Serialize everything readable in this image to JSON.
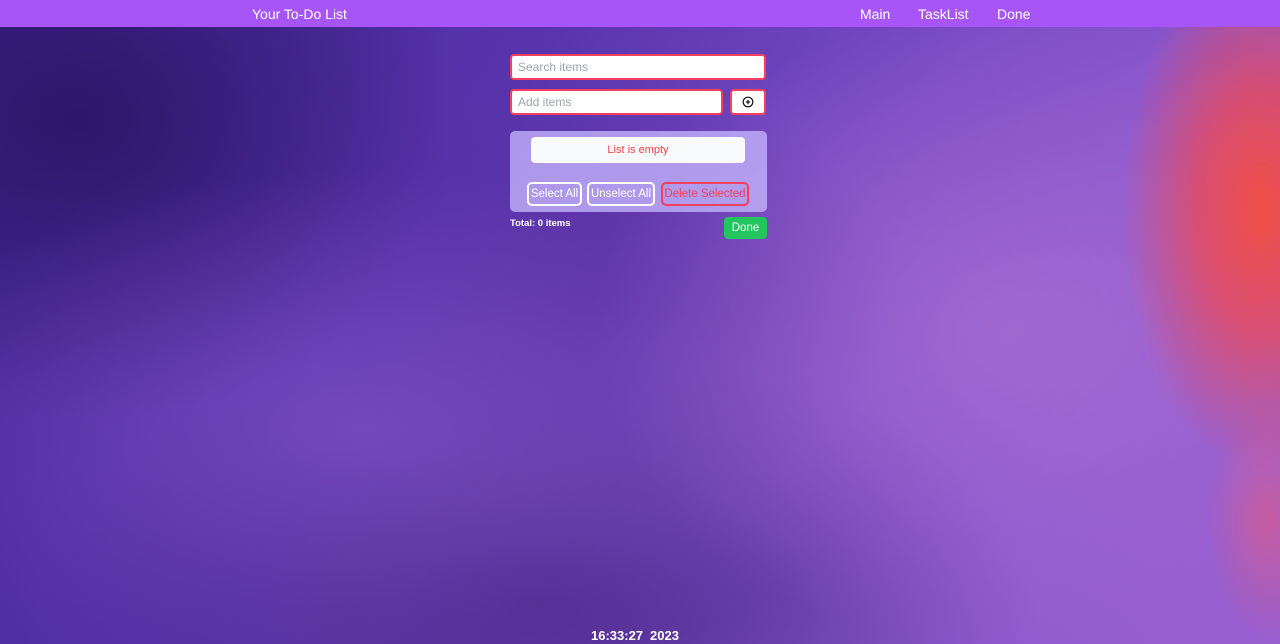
{
  "navbar": {
    "brand": "Your To-Do List",
    "links": [
      "Main",
      "TaskList",
      "Done"
    ]
  },
  "search": {
    "placeholder": "Search items",
    "value": ""
  },
  "add": {
    "placeholder": "Add items",
    "value": "",
    "button_icon": "plus-circle-icon"
  },
  "list": {
    "empty_message": "List is empty",
    "select_all_label": "Select All",
    "unselect_all_label": "Unselect All",
    "delete_selected_label": "Delete Selected"
  },
  "footer": {
    "total_text": "Total: 0 items",
    "done_label": "Done"
  },
  "clock": {
    "time": "16:33:27",
    "year": "2023"
  },
  "colors": {
    "navbar": "#a855f7",
    "input_border": "#f43f5e",
    "empty_text": "#ef4444",
    "done_button": "#22c55e"
  }
}
